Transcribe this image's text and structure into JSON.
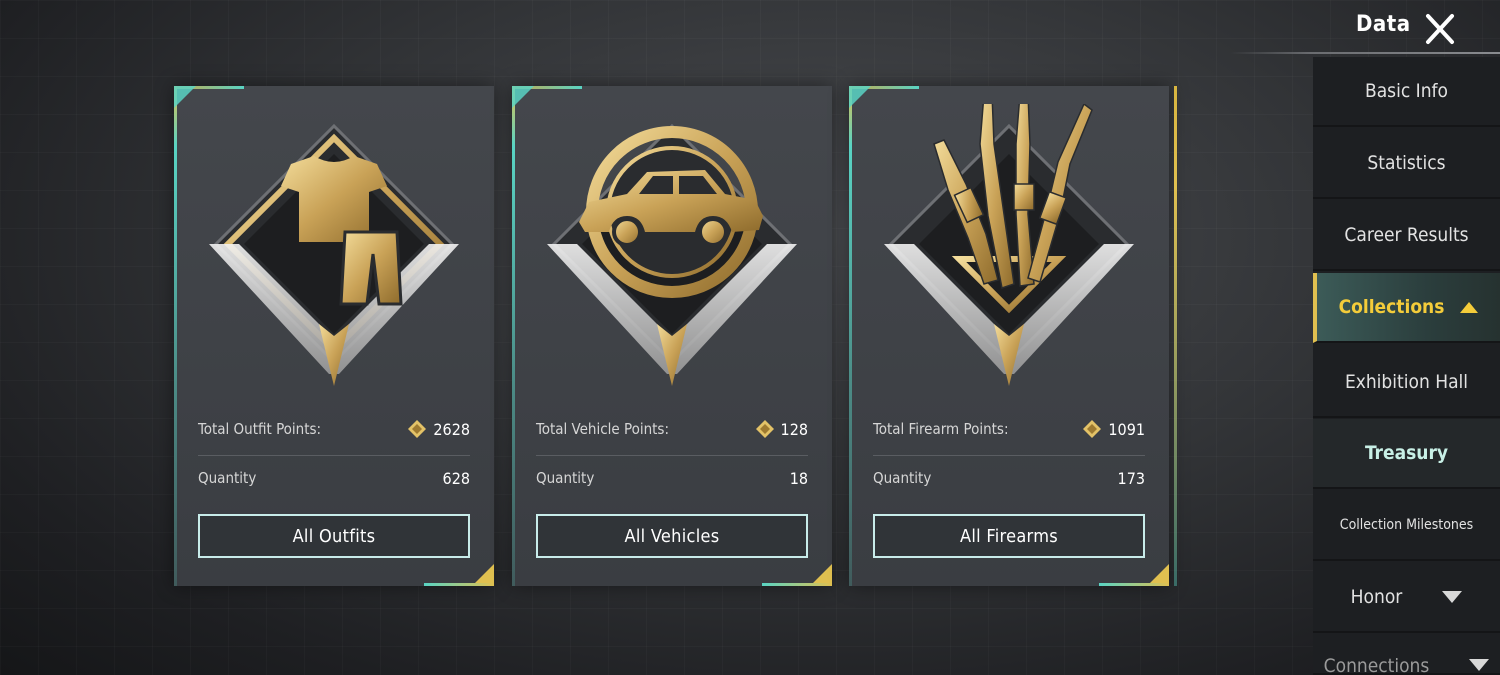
{
  "header": {
    "title": "Data",
    "close_icon": "close-icon"
  },
  "cards": [
    {
      "emblem": "outfit-emblem-icon",
      "points_label": "Total Outfit Points:",
      "points_value": "2628",
      "quantity_label": "Quantity",
      "quantity_value": "628",
      "button_label": "All Outfits"
    },
    {
      "emblem": "vehicle-emblem-icon",
      "points_label": "Total Vehicle Points:",
      "points_value": "128",
      "quantity_label": "Quantity",
      "quantity_value": "18",
      "button_label": "All Vehicles"
    },
    {
      "emblem": "firearm-emblem-icon",
      "points_label": "Total Firearm Points:",
      "points_value": "1091",
      "quantity_label": "Quantity",
      "quantity_value": "173",
      "button_label": "All Firearms"
    }
  ],
  "sidebar": {
    "items": [
      {
        "label": "Basic Info"
      },
      {
        "label": "Statistics"
      },
      {
        "label": "Career Results"
      },
      {
        "label": "Collections",
        "active": true,
        "expanded": true
      },
      {
        "label": "Exhibition Hall"
      },
      {
        "label": "Treasury",
        "selected_sub": true
      },
      {
        "label": "Collection Milestones"
      },
      {
        "label": "Honor",
        "collapsed": true
      },
      {
        "label": "Connections"
      }
    ]
  },
  "colors": {
    "gold": "#e0c050",
    "teal": "#59d4c4",
    "active_text": "#f4cc3a"
  }
}
